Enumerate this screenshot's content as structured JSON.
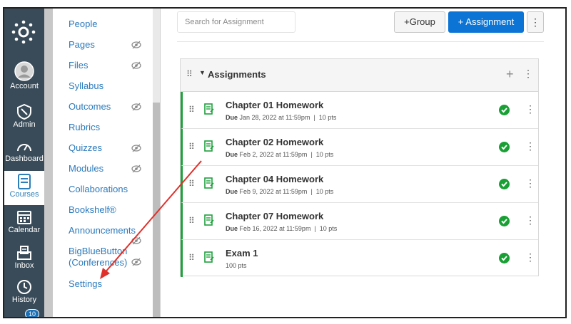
{
  "global_nav": {
    "items": [
      {
        "label": "Account",
        "icon": "account-icon"
      },
      {
        "label": "Admin",
        "icon": "admin-icon"
      },
      {
        "label": "Dashboard",
        "icon": "dashboard-icon"
      },
      {
        "label": "Courses",
        "icon": "courses-icon",
        "active": true
      },
      {
        "label": "Calendar",
        "icon": "calendar-icon"
      },
      {
        "label": "Inbox",
        "icon": "inbox-icon"
      },
      {
        "label": "History",
        "icon": "history-icon"
      }
    ],
    "badge_count": "10"
  },
  "course_nav": {
    "items": [
      {
        "label": "People",
        "hidden": false
      },
      {
        "label": "Pages",
        "hidden": true
      },
      {
        "label": "Files",
        "hidden": true
      },
      {
        "label": "Syllabus",
        "hidden": false
      },
      {
        "label": "Outcomes",
        "hidden": true
      },
      {
        "label": "Rubrics",
        "hidden": false
      },
      {
        "label": "Quizzes",
        "hidden": true
      },
      {
        "label": "Modules",
        "hidden": true
      },
      {
        "label": "Collaborations",
        "hidden": false
      },
      {
        "label": "Bookshelf®",
        "hidden": false
      },
      {
        "label": "Announcements",
        "hidden": false
      },
      {
        "label": "BigBlueButton",
        "label2": "(Conferences)",
        "hidden": true
      },
      {
        "label": "Settings",
        "hidden": false
      }
    ]
  },
  "toolbar": {
    "search_placeholder": "Search for Assignment",
    "group_button": "+Group",
    "assignment_button": "+ Assignment",
    "more_glyph": "⋮"
  },
  "assignment_group": {
    "title": "Assignments",
    "rows": [
      {
        "title": "Chapter 01 Homework",
        "due_label": "Due",
        "due": "Jan 28, 2022 at 11:59pm",
        "points": "10 pts"
      },
      {
        "title": "Chapter 02 Homework",
        "due_label": "Due",
        "due": "Feb 2, 2022 at 11:59pm",
        "points": "10 pts"
      },
      {
        "title": "Chapter 04 Homework",
        "due_label": "Due",
        "due": "Feb 9, 2022 at 11:59pm",
        "points": "10 pts"
      },
      {
        "title": "Chapter 07 Homework",
        "due_label": "Due",
        "due": "Feb 16, 2022 at 11:59pm",
        "points": "10 pts"
      },
      {
        "title": "Exam 1",
        "due_label": "",
        "due": "",
        "points": "100 pts"
      }
    ]
  },
  "colors": {
    "nav_bg": "#394b58",
    "link": "#2b7abc",
    "primary": "#0b74d5",
    "published": "#19a034",
    "annotation_arrow": "#e0302b"
  }
}
